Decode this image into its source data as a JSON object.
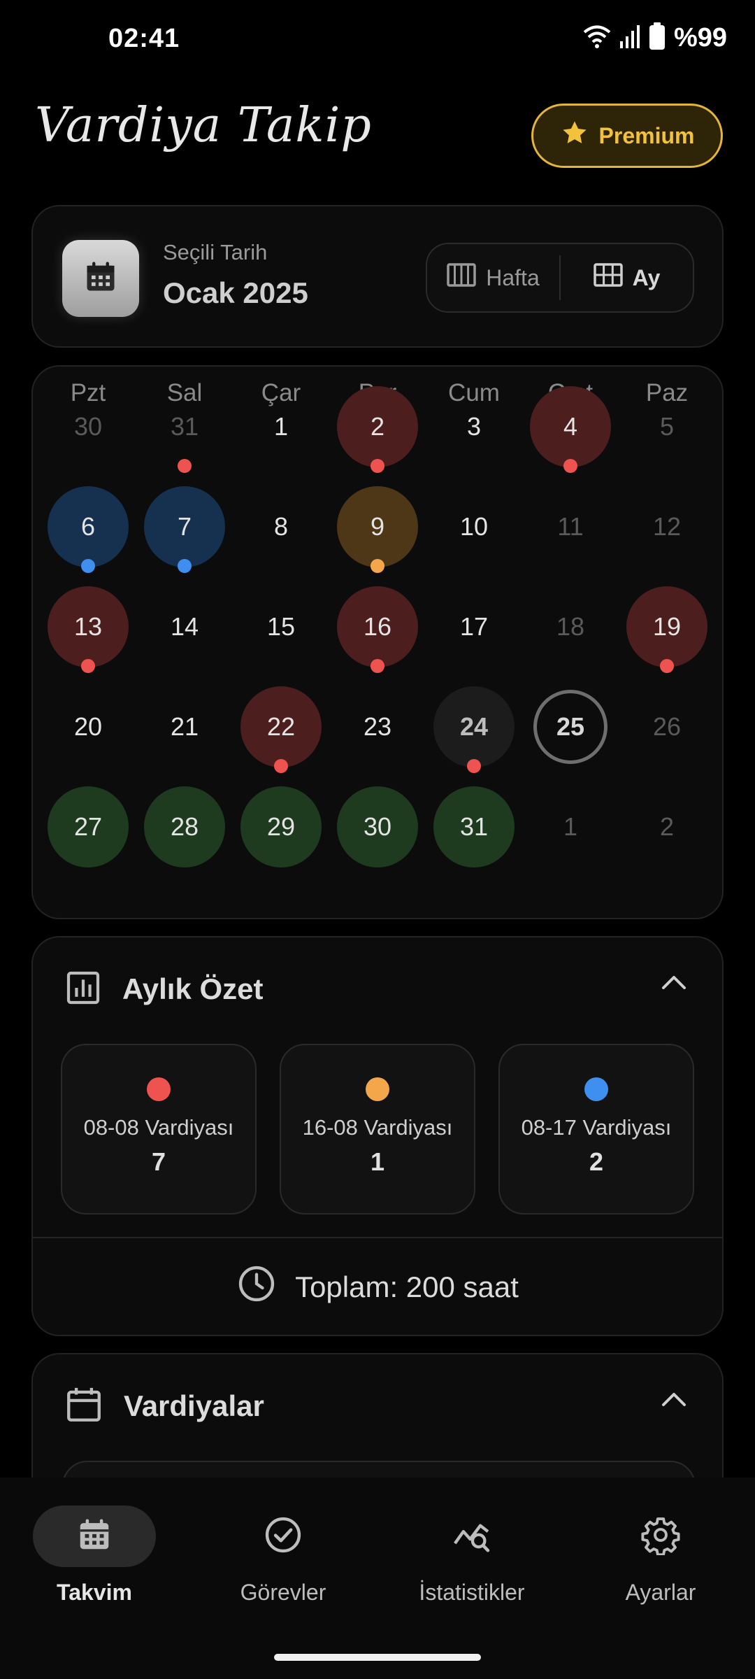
{
  "status_bar": {
    "time": "02:41",
    "battery": "%99"
  },
  "app": {
    "title": "Vardiya Takip",
    "premium_label": "Premium"
  },
  "date_selector": {
    "label": "Seçili Tarih",
    "value": "Ocak 2025",
    "views": [
      {
        "label": "Hafta",
        "active": false
      },
      {
        "label": "Ay",
        "active": true
      }
    ]
  },
  "calendar": {
    "weekdays": [
      "Pzt",
      "Sal",
      "Çar",
      "Per",
      "Cum",
      "Cmt",
      "Paz"
    ],
    "weeks": [
      [
        {
          "d": "30",
          "muted": true
        },
        {
          "d": "31",
          "muted": true,
          "dot": "red"
        },
        {
          "d": "1"
        },
        {
          "d": "2",
          "bg": "red",
          "dot": "red"
        },
        {
          "d": "3"
        },
        {
          "d": "4",
          "bg": "red",
          "dot": "red"
        },
        {
          "d": "5",
          "muted": true
        }
      ],
      [
        {
          "d": "6",
          "bg": "blue",
          "dot": "blue"
        },
        {
          "d": "7",
          "bg": "blue",
          "dot": "blue"
        },
        {
          "d": "8"
        },
        {
          "d": "9",
          "bg": "orange",
          "dot": "orange"
        },
        {
          "d": "10"
        },
        {
          "d": "11",
          "muted": true
        },
        {
          "d": "12",
          "muted": true
        }
      ],
      [
        {
          "d": "13",
          "bg": "red",
          "dot": "red"
        },
        {
          "d": "14"
        },
        {
          "d": "15"
        },
        {
          "d": "16",
          "bg": "red",
          "dot": "red"
        },
        {
          "d": "17"
        },
        {
          "d": "18",
          "muted": true
        },
        {
          "d": "19",
          "bg": "red",
          "dot": "red"
        }
      ],
      [
        {
          "d": "20"
        },
        {
          "d": "21"
        },
        {
          "d": "22",
          "bg": "red",
          "dot": "red"
        },
        {
          "d": "23"
        },
        {
          "d": "24",
          "bg": "dark",
          "dot": "red"
        },
        {
          "d": "25",
          "today": true
        },
        {
          "d": "26",
          "muted": true
        }
      ],
      [
        {
          "d": "27",
          "bg": "green"
        },
        {
          "d": "28",
          "bg": "green"
        },
        {
          "d": "29",
          "bg": "green"
        },
        {
          "d": "30",
          "bg": "green"
        },
        {
          "d": "31",
          "bg": "green"
        },
        {
          "d": "1",
          "muted": true
        },
        {
          "d": "2",
          "muted": true
        }
      ]
    ]
  },
  "monthly_summary": {
    "title": "Aylık Özet",
    "items": [
      {
        "name": "08-08 Vardiyası",
        "count": "7",
        "color": "#ef5350"
      },
      {
        "name": "16-08 Vardiyası",
        "count": "1",
        "color": "#f3a64a"
      },
      {
        "name": "08-17 Vardiyası",
        "count": "2",
        "color": "#3f8ff0"
      }
    ],
    "total": "Toplam: 200 saat"
  },
  "shifts": {
    "title": "Vardiyalar"
  },
  "nav": [
    {
      "label": "Takvim",
      "icon": "calendar-icon",
      "active": true
    },
    {
      "label": "Görevler",
      "icon": "check-circle-icon",
      "active": false
    },
    {
      "label": "İstatistikler",
      "icon": "stats-search-icon",
      "active": false
    },
    {
      "label": "Ayarlar",
      "icon": "gear-icon",
      "active": false
    }
  ]
}
